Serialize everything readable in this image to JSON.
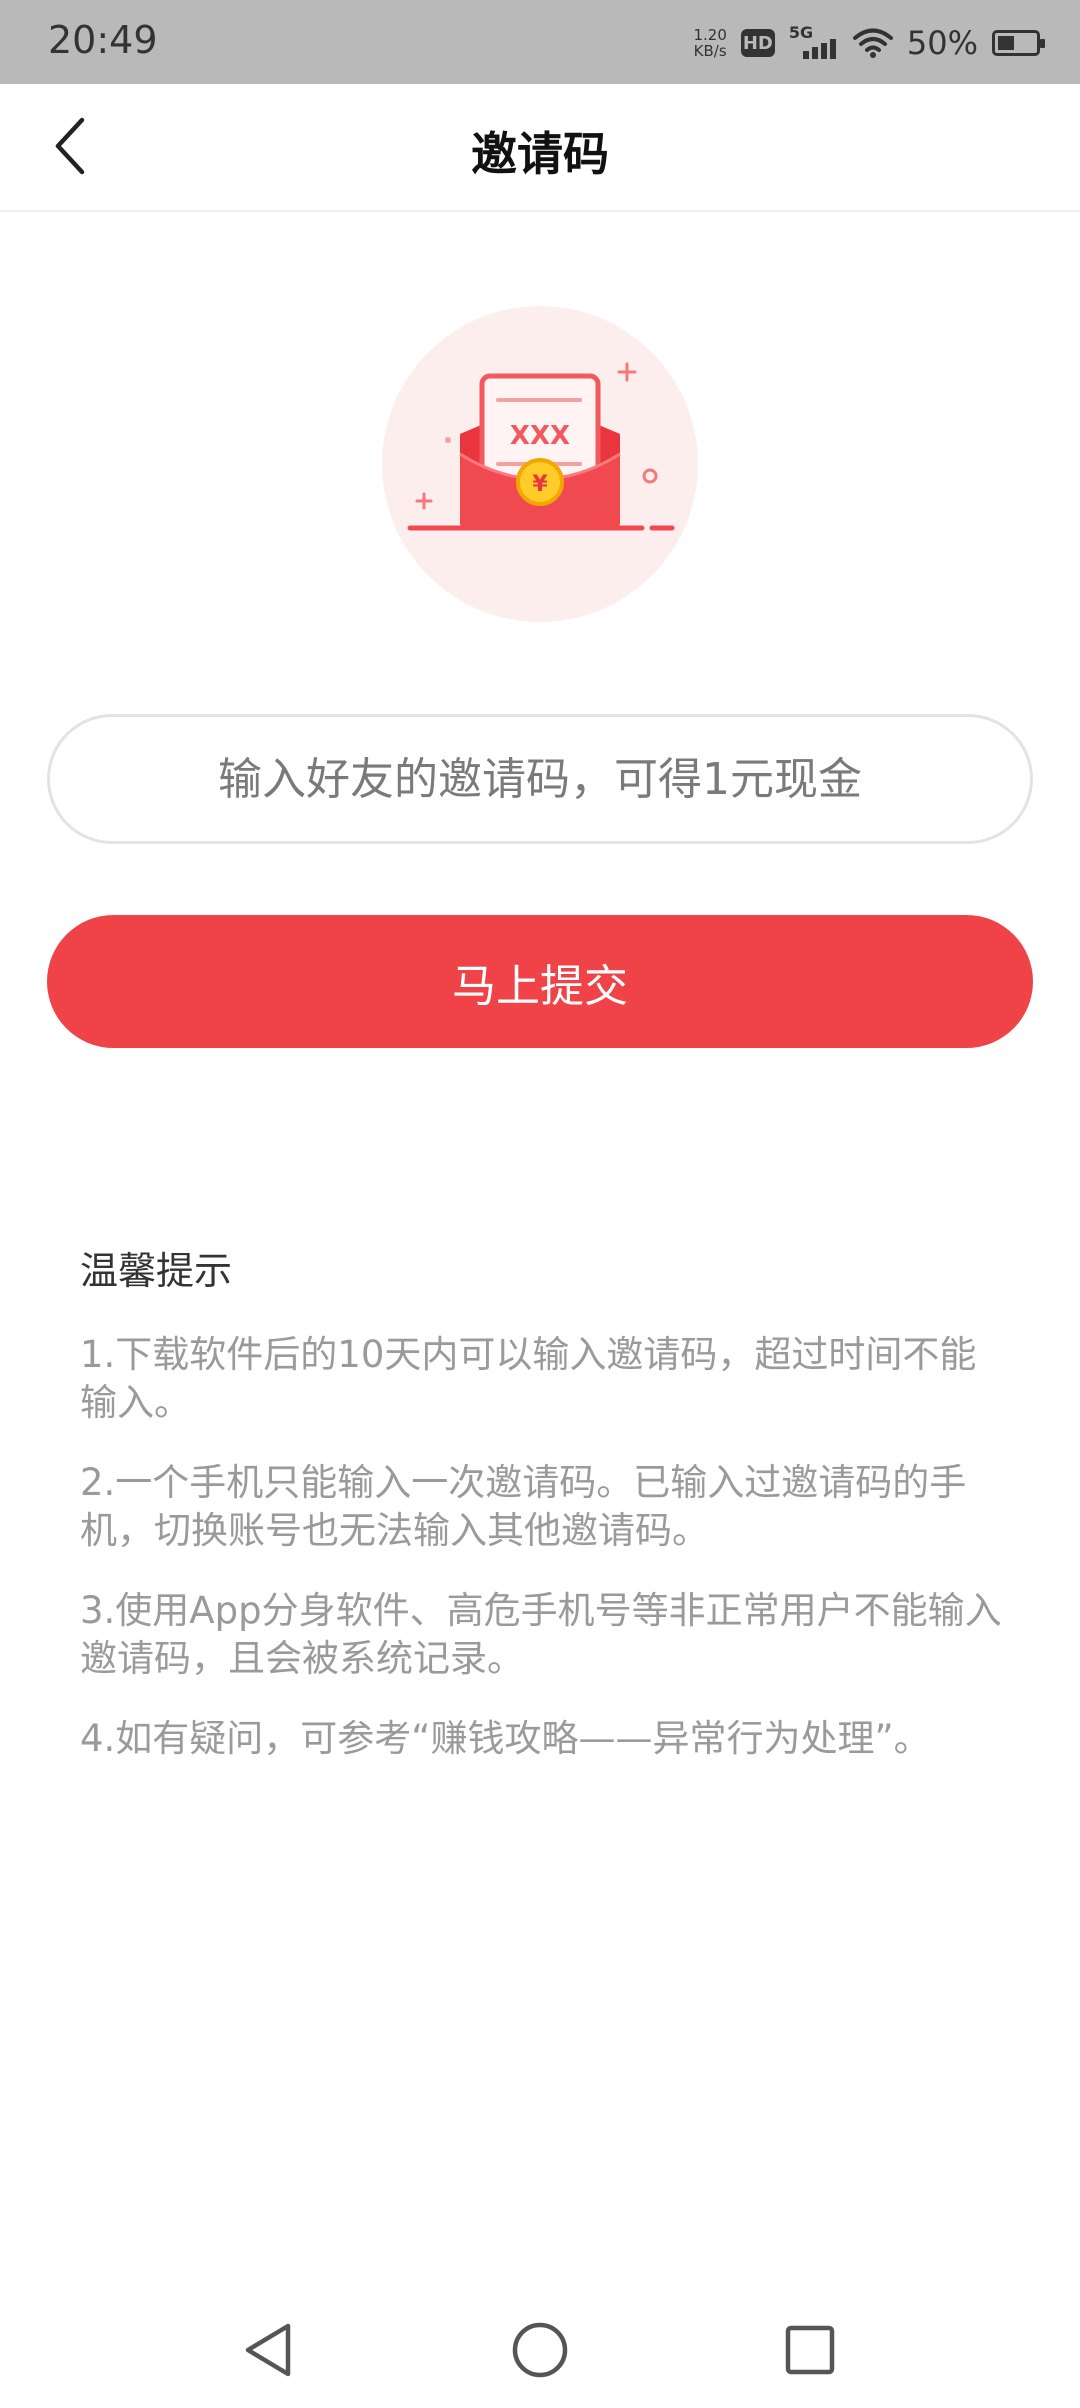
{
  "status_bar": {
    "time": "20:49",
    "net_speed_value": "1.20",
    "net_speed_unit": "KB/s",
    "hd": "HD",
    "network": "5G",
    "battery": "50%"
  },
  "header": {
    "title": "邀请码"
  },
  "invite": {
    "placeholder": "输入好友的邀请码，可得1元现金",
    "value": ""
  },
  "submit": {
    "label": "马上提交"
  },
  "tips": {
    "title": "温馨提示",
    "items": [
      "1.下载软件后的10天内可以输入邀请码，超过时间不能输入。",
      "2.一个手机只能输入一次邀请码。已输入过邀请码的手机，切换账号也无法输入其他邀请码。",
      "3.使用App分身软件、高危手机号等非正常用户不能输入邀请码，且会被系统记录。",
      "4.如有疑问，可参考“赚钱攻略——异常行为处理”。"
    ]
  },
  "illustration": {
    "card_text": "XXX",
    "coin_symbol": "¥"
  },
  "colors": {
    "accent": "#ef4347",
    "status_bar_bg": "#b9b9b9",
    "tip_text": "#9a9a9a"
  }
}
